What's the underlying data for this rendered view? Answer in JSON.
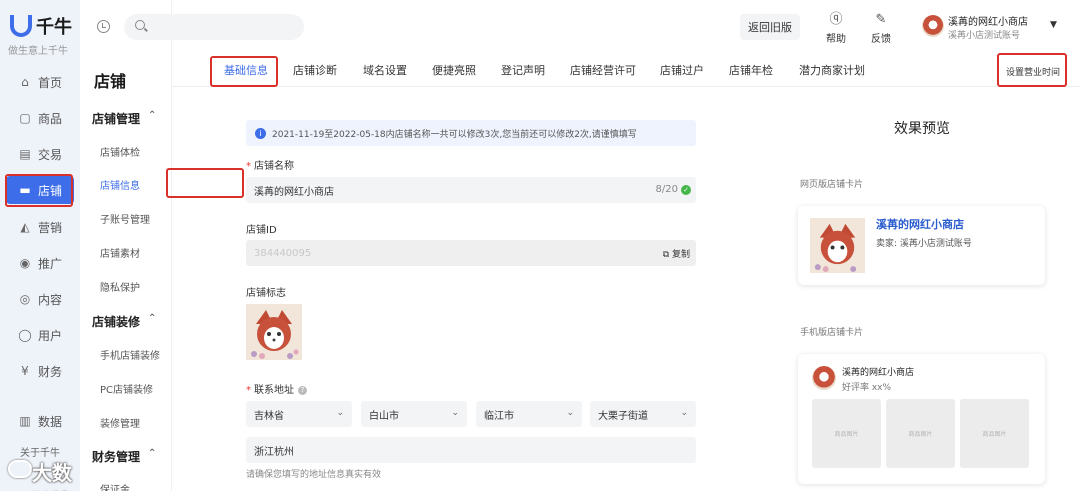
{
  "brand": {
    "name": "千牛",
    "slogan": "做生意上千牛",
    "accent": "#3d6de8",
    "highlight": "#d9312a"
  },
  "left_nav": [
    {
      "label": "首页",
      "icon": "home-icon",
      "glyph": "⌂"
    },
    {
      "label": "商品",
      "icon": "goods-icon",
      "glyph": "▢"
    },
    {
      "label": "交易",
      "icon": "trade-icon",
      "glyph": "▤"
    },
    {
      "label": "店铺",
      "icon": "store-icon",
      "glyph": "▬"
    },
    {
      "label": "营销",
      "icon": "marketing-icon",
      "glyph": "◭"
    },
    {
      "label": "推广",
      "icon": "promote-icon",
      "glyph": "◉"
    },
    {
      "label": "内容",
      "icon": "content-icon",
      "glyph": "◎"
    },
    {
      "label": "用户",
      "icon": "user-icon",
      "glyph": "◯"
    },
    {
      "label": "财务",
      "icon": "finance-icon",
      "glyph": "¥"
    },
    {
      "label": "数据",
      "icon": "data-icon",
      "glyph": "▥"
    }
  ],
  "about": "关于千牛",
  "watermark": "大数跨境",
  "sub_nav": {
    "title": "店铺",
    "groups": [
      {
        "label": "店铺管理",
        "items": [
          "店铺体检",
          "店铺信息",
          "子账号管理",
          "店铺素材",
          "隐私保护"
        ]
      },
      {
        "label": "店铺装修",
        "items": [
          "手机店铺装修",
          "PC店铺装修",
          "装修管理"
        ]
      },
      {
        "label": "财务管理",
        "items": [
          "保证金"
        ]
      }
    ]
  },
  "header": {
    "back_old": "返回旧版",
    "help": "帮助",
    "feedback": "反馈",
    "shop_name": "溪苒的网红小商店",
    "account": "溪苒小店测试账号"
  },
  "tabs": [
    "基础信息",
    "店铺诊断",
    "域名设置",
    "便捷亮照",
    "登记声明",
    "店铺经营许可",
    "店铺过户",
    "店铺年检",
    "潜力商家计划"
  ],
  "set_hours": "设置营业时间",
  "form": {
    "notice": "2021-11-19至2022-05-18内店铺名称一共可以修改3次,您当前还可以修改2次,请谨慎填写",
    "name_label": "店铺名称",
    "name_value": "溪苒的网红小商店",
    "name_count": "8/20",
    "id_label": "店铺ID",
    "id_value": "384440095",
    "copy": "复制",
    "logo_label": "店铺标志",
    "address_label": "联系地址",
    "province": "吉林省",
    "city": "白山市",
    "district": "临江市",
    "street": "大栗子街道",
    "detail": "浙江杭州",
    "hint": "请确保您填写的地址信息真实有效"
  },
  "preview": {
    "title": "效果预览",
    "web_label": "网页版店铺卡片",
    "web_name": "溪苒的网红小商店",
    "seller": "卖家: 溪苒小店测试账号",
    "mobile_label": "手机版店铺卡片",
    "mobile_name": "溪苒的网红小商店",
    "rating": "好评率 xx%",
    "product_placeholder": "商品图片"
  }
}
